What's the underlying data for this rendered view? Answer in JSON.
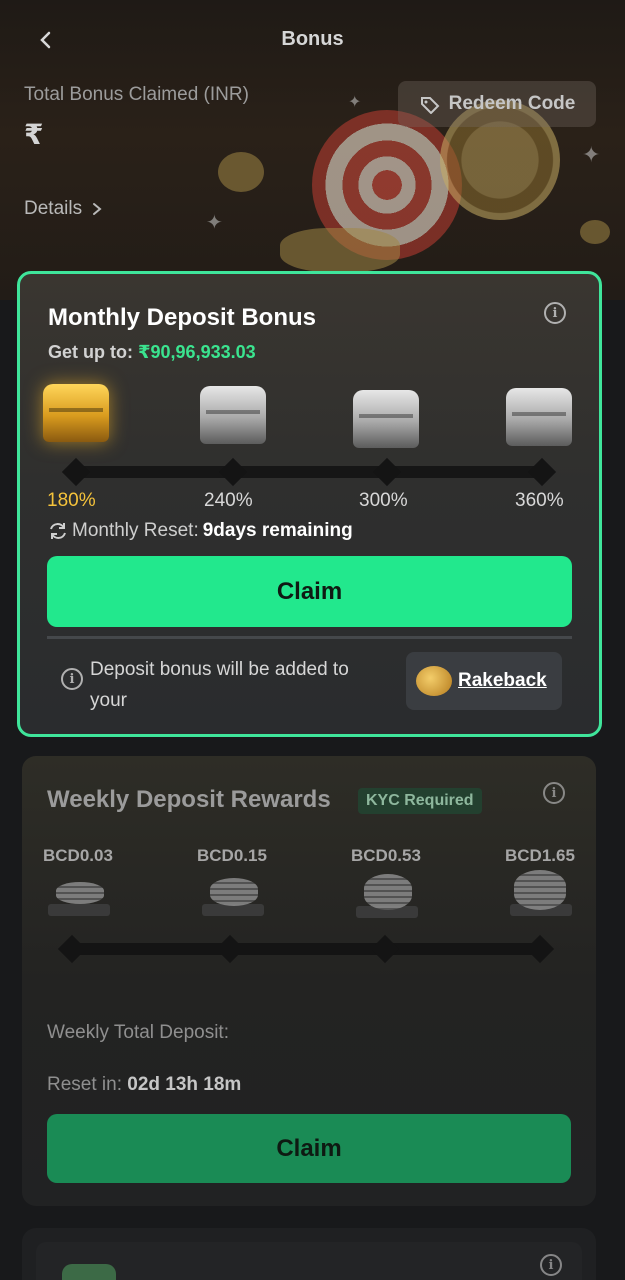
{
  "header": {
    "title": "Bonus",
    "back_icon": "chevron-left-icon"
  },
  "summary": {
    "total_label": "Total Bonus Claimed (INR)",
    "amount_symbol": "₹",
    "details_label": "Details",
    "redeem_label": "Redeem Code"
  },
  "monthly": {
    "title": "Monthly Deposit Bonus",
    "getup_label": "Get up to:",
    "getup_amount": "₹90,96,933.03",
    "tiers": [
      {
        "label": "180%",
        "chest": "gold"
      },
      {
        "label": "240%",
        "chest": "silver"
      },
      {
        "label": "300%",
        "chest": "silver"
      },
      {
        "label": "360%",
        "chest": "silver"
      }
    ],
    "reset_label": "Monthly Reset:",
    "reset_value": "9days remaining",
    "claim_label": "Claim",
    "note": "Deposit bonus will be added to your",
    "rakeback_label": "Rakeback"
  },
  "weekly": {
    "title": "Weekly Deposit Rewards",
    "kyc_badge": "KYC Required",
    "rewards": [
      "BCD0.03",
      "BCD0.15",
      "BCD0.53",
      "BCD1.65"
    ],
    "total_label": "Weekly Total Deposit:",
    "reset_label": "Reset in:",
    "reset_value": "02d 13h 18m",
    "claim_label": "Claim"
  },
  "colors": {
    "accent": "#22e88d",
    "highlight": "#f5c33b",
    "border": "#3fe59b"
  }
}
